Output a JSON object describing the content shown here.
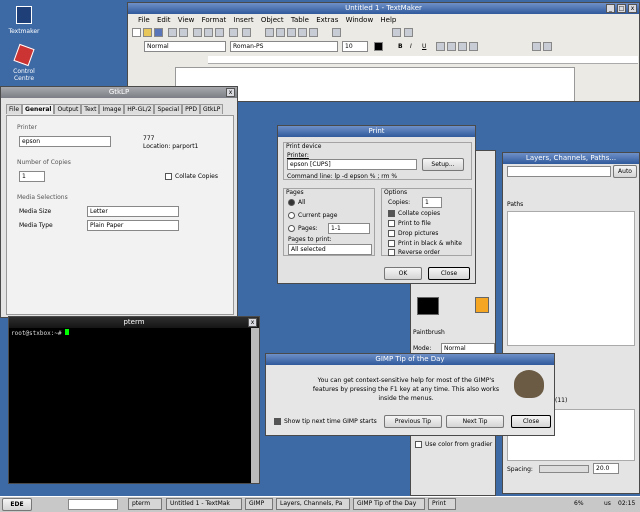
{
  "desktop": {
    "icons": [
      {
        "label": "Textmaker"
      },
      {
        "label": "Control\nCentre"
      }
    ]
  },
  "textmaker": {
    "title": "Untitled 1 - TextMaker",
    "menu": [
      "File",
      "Edit",
      "View",
      "Format",
      "Insert",
      "Object",
      "Table",
      "Extras",
      "Window",
      "Help"
    ],
    "style_value": "Normal",
    "font_value": "Roman-PS",
    "size_value": "10",
    "bold": "B",
    "italic": "I",
    "underline": "U"
  },
  "gtklp": {
    "title": "GtkLP",
    "tabs": [
      "File",
      "General",
      "Output",
      "Text",
      "Image",
      "HP-GL/2",
      "Special",
      "PPD",
      "GtkLP"
    ],
    "printer_group": "Printer",
    "printer_value": "epson",
    "printer_id": "777",
    "location": "Location: parport1",
    "copies_group": "Number of Copies",
    "copies_value": "1",
    "collate_label": "Collate Copies",
    "media_group": "Media Selections",
    "media_size_label": "Media Size",
    "media_size_value": "Letter",
    "media_type_label": "Media Type",
    "media_type_value": "Plain Paper"
  },
  "pterm": {
    "title": "pterm",
    "prompt": "root@stxbox:~# "
  },
  "print_dialog": {
    "title": "Print",
    "device_group": "Print device",
    "printer_label": "Printer:",
    "printer_value": "epson [CUPS]",
    "setup_button": "Setup...",
    "command_line": "Command line: lp -d epson % ; rm %",
    "pages_group": "Pages",
    "all_label": "All",
    "current_label": "Current page",
    "pages_label": "Pages:",
    "pages_value": "1-1",
    "pages_to_print_label": "Pages to print:",
    "pages_to_print_value": "All selected",
    "options_group": "Options",
    "copies_label": "Copies:",
    "copies_value": "1",
    "collate_label": "Collate copies",
    "print_to_file_label": "Print to file",
    "drop_pictures_label": "Drop pictures",
    "bw_label": "Print in black & white",
    "reverse_label": "Reverse order",
    "ok_button": "OK",
    "close_button": "Close"
  },
  "gimp_toolbox": {
    "tool_label": "Paintbrush",
    "mode_label": "Mode:",
    "mode_value": "Normal",
    "gradient_label": "Use color from gradier"
  },
  "layers": {
    "title": "Layers, Channels, Paths...",
    "auto_button": "Auto",
    "paths_label": "Paths",
    "brush_size": "(11)",
    "spacing_label": "Spacing:",
    "spacing_value": "20.0"
  },
  "tip_dialog": {
    "title": "GIMP Tip of the Day",
    "tip_text": "You can get context-sensitive help for most of the GIMP's features by pressing the F1 key at any time. This also works inside the menus.",
    "show_next_label": "Show tip next time GIMP starts",
    "prev_button": "Previous Tip",
    "next_button": "Next Tip",
    "close_button": "Close"
  },
  "taskbar": {
    "start_label": "EDE",
    "tasks": [
      "pterm",
      "Untitled 1 - TextMak",
      "GIMP",
      "Layers, Channels, Pa",
      "GIMP Tip of the Day",
      "Print"
    ],
    "battery": "6%",
    "lang": "us",
    "clock": "02:15"
  }
}
